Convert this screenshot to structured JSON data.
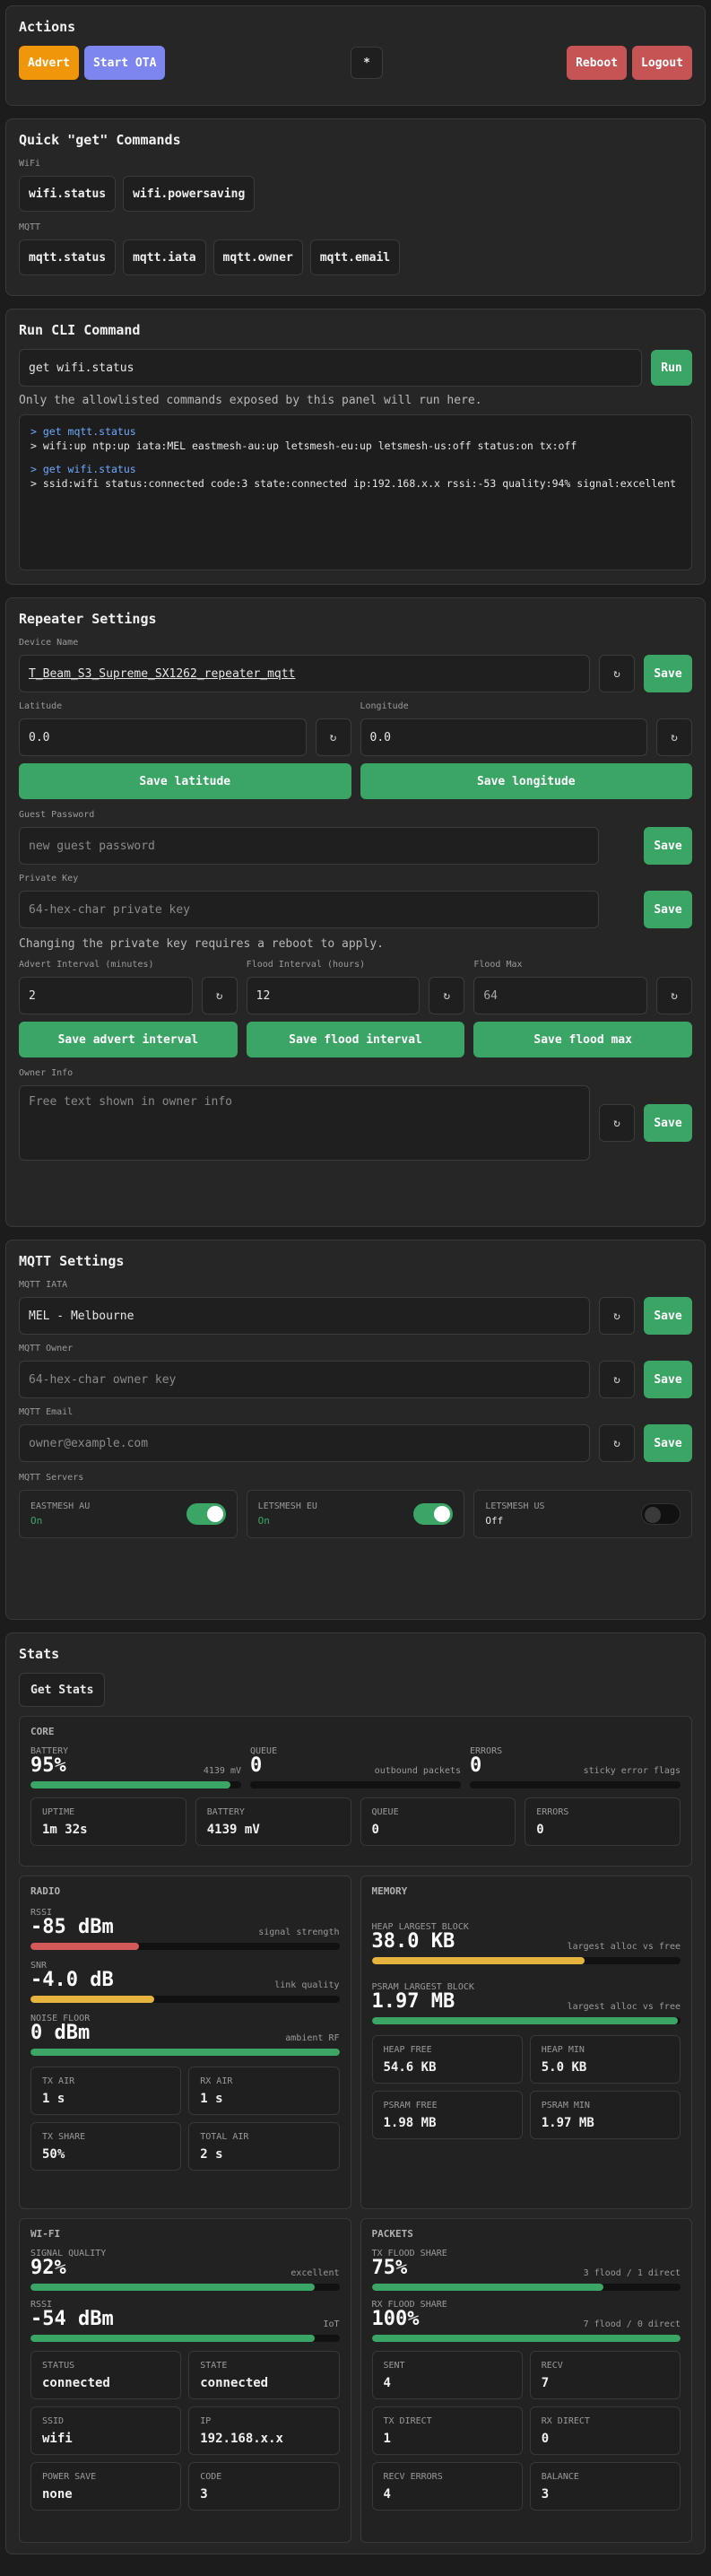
{
  "actions": {
    "title": "Actions",
    "advert": "Advert",
    "start_ota": "Start OTA",
    "theme_icon": "*",
    "reboot": "Reboot",
    "logout": "Logout"
  },
  "quick": {
    "title": "Quick \"get\" Commands",
    "wifi_label": "WiFi",
    "wifi": [
      "wifi.status",
      "wifi.powersaving"
    ],
    "mqtt_label": "MQTT",
    "mqtt": [
      "mqtt.status",
      "mqtt.iata",
      "mqtt.owner",
      "mqtt.email"
    ]
  },
  "cli": {
    "title": "Run CLI Command",
    "input": "get wifi.status",
    "run": "Run",
    "note": "Only the allowlisted commands exposed by this panel will run here.",
    "output": [
      {
        "cmd": "> get mqtt.status",
        "resp": "> wifi:up ntp:up iata:MEL eastmesh-au:up letsmesh-eu:up letsmesh-us:off status:on tx:off"
      },
      {
        "cmd": "> get wifi.status",
        "resp": "> ssid:wifi status:connected code:3 state:connected ip:192.168.x.x rssi:-53 quality:94% signal:excellent"
      }
    ]
  },
  "repeater": {
    "title": "Repeater Settings",
    "device_name_label": "Device Name",
    "device_name": "T_Beam_S3_Supreme_SX1262_repeater_mqtt",
    "latitude_label": "Latitude",
    "latitude": "0.0",
    "longitude_label": "Longitude",
    "longitude": "0.0",
    "save_latitude": "Save latitude",
    "save_longitude": "Save longitude",
    "guest_label": "Guest Password",
    "guest_placeholder": "new guest password",
    "pk_label": "Private Key",
    "pk_placeholder": "64-hex-char private key",
    "pk_note": "Changing the private key requires a reboot to apply.",
    "advert_label": "Advert Interval (minutes)",
    "advert": "2",
    "flood_label": "Flood Interval (hours)",
    "flood": "12",
    "floodmax_label": "Flood Max",
    "floodmax": "64",
    "save_advert": "Save advert interval",
    "save_flood": "Save flood interval",
    "save_floodmax": "Save flood max",
    "owner_label": "Owner Info",
    "owner_placeholder": "Free text shown in owner info",
    "save": "Save",
    "reset_icon": "↻"
  },
  "mqtt": {
    "title": "MQTT Settings",
    "iata_label": "MQTT IATA",
    "iata": "MEL - Melbourne",
    "owner_label": "MQTT Owner",
    "owner_placeholder": "64-hex-char owner key",
    "email_label": "MQTT Email",
    "email_placeholder": "owner@example.com",
    "servers_label": "MQTT Servers",
    "servers": [
      {
        "name": "EASTMESH AU",
        "state": "On",
        "on": true
      },
      {
        "name": "LETSMESH EU",
        "state": "On",
        "on": true
      },
      {
        "name": "LETSMESH US",
        "state": "Off",
        "on": false
      }
    ]
  },
  "stats": {
    "title": "Stats",
    "get_stats": "Get Stats",
    "core": {
      "title": "CORE",
      "battery_label": "BATTERY",
      "battery": "95%",
      "battery_mv": "4139 mV",
      "battery_fill": 0.95,
      "queue_label": "QUEUE",
      "queue": "0",
      "queue_hint": "outbound packets",
      "queue_fill": 0,
      "errors_label": "ERRORS",
      "errors": "0",
      "errors_hint": "sticky error flags",
      "errors_fill": 0,
      "minis": [
        {
          "k": "UPTIME",
          "v": "1m 32s"
        },
        {
          "k": "BATTERY",
          "v": "4139 mV"
        },
        {
          "k": "QUEUE",
          "v": "0"
        },
        {
          "k": "ERRORS",
          "v": "0"
        }
      ]
    },
    "radio": {
      "title": "RADIO",
      "rssi_label": "RSSI",
      "rssi": "-85 dBm",
      "rssi_hint": "signal strength",
      "rssi_fill": 0.35,
      "rssi_color": "#d45a5a",
      "snr_label": "SNR",
      "snr": "-4.0 dB",
      "snr_hint": "link quality",
      "snr_fill": 0.4,
      "snr_color": "#e6b43c",
      "noise_label": "NOISE FLOOR",
      "noise": "0 dBm",
      "noise_hint": "ambient RF",
      "noise_fill": 1.0,
      "noise_color": "#3ba565",
      "minis": [
        {
          "k": "TX AIR",
          "v": "1 s"
        },
        {
          "k": "RX AIR",
          "v": "1 s"
        },
        {
          "k": "TX SHARE",
          "v": "50%"
        },
        {
          "k": "TOTAL AIR",
          "v": "2 s"
        }
      ]
    },
    "memory": {
      "title": "MEMORY",
      "heap_label": "HEAP LARGEST BLOCK",
      "heap": "38.0 KB",
      "heap_hint": "largest alloc vs free",
      "heap_fill": 0.69,
      "heap_color": "#e6b43c",
      "psram_label": "PSRAM LARGEST BLOCK",
      "psram": "1.97 MB",
      "psram_hint": "largest alloc vs free",
      "psram_fill": 0.99,
      "psram_color": "#3ba565",
      "minis": [
        {
          "k": "HEAP FREE",
          "v": "54.6 KB"
        },
        {
          "k": "HEAP MIN",
          "v": "5.0 KB"
        },
        {
          "k": "PSRAM FREE",
          "v": "1.98 MB"
        },
        {
          "k": "PSRAM MIN",
          "v": "1.97 MB"
        }
      ]
    },
    "wifi": {
      "title": "WI-FI",
      "quality_label": "SIGNAL QUALITY",
      "quality": "92%",
      "quality_hint": "excellent",
      "quality_fill": 0.92,
      "rssi_label": "RSSI",
      "rssi": "-54 dBm",
      "rssi_hint": "IoT",
      "rssi_fill": 0.92,
      "minis": [
        {
          "k": "STATUS",
          "v": "connected"
        },
        {
          "k": "STATE",
          "v": "connected"
        },
        {
          "k": "SSID",
          "v": "wifi"
        },
        {
          "k": "IP",
          "v": "192.168.x.x"
        },
        {
          "k": "POWER SAVE",
          "v": "none"
        },
        {
          "k": "CODE",
          "v": "3"
        }
      ]
    },
    "packets": {
      "title": "PACKETS",
      "tx_label": "TX FLOOD SHARE",
      "tx": "75%",
      "tx_hint": "3 flood / 1 direct",
      "tx_fill": 0.75,
      "rx_label": "RX FLOOD SHARE",
      "rx": "100%",
      "rx_hint": "7 flood / 0 direct",
      "rx_fill": 1.0,
      "minis": [
        {
          "k": "SENT",
          "v": "4"
        },
        {
          "k": "RECV",
          "v": "7"
        },
        {
          "k": "TX DIRECT",
          "v": "1"
        },
        {
          "k": "RX DIRECT",
          "v": "0"
        },
        {
          "k": "RECV ERRORS",
          "v": "4"
        },
        {
          "k": "BALANCE",
          "v": "3"
        }
      ]
    }
  }
}
